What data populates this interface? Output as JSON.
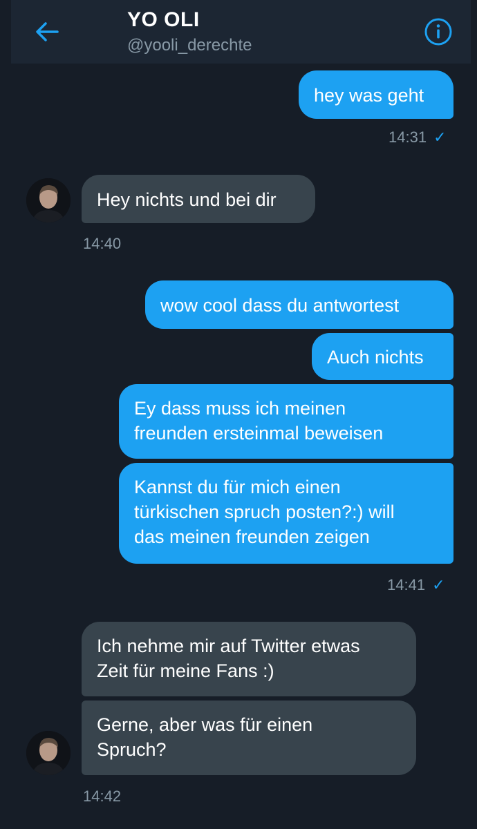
{
  "header": {
    "name": "YO OLI",
    "handle": "@yooli_derechte"
  },
  "messages": {
    "m1": "hey was geht",
    "t1": "14:31",
    "m2": "Hey nichts und bei dir",
    "t2": "14:40",
    "m3": "wow cool dass du antwortest",
    "m4": "Auch nichts",
    "m5_line1": "Ey dass muss ich meinen",
    "m5_line2": "freunden ersteinmal beweisen",
    "m6_line1": "Kannst du für mich einen",
    "m6_line2": "türkischen spruch posten?:) will",
    "m6_line3": "das meinen freunden zeigen",
    "t3": "14:41",
    "m7_line1": "Ich nehme mir auf Twitter etwas",
    "m7_line2": "Zeit für meine Fans :)",
    "m8_line1": "Gerne, aber was für einen",
    "m8_line2": "Spruch?",
    "t4": "14:42"
  },
  "colors": {
    "background": "#161d27",
    "header": "#1c2633",
    "sent_bubble": "#1da1f2",
    "received_bubble": "#38444d",
    "accent": "#1da1f2",
    "muted_text": "#8899a6"
  },
  "icons": {
    "back": "back-arrow-icon",
    "info": "info-icon",
    "read": "checkmark-icon"
  }
}
